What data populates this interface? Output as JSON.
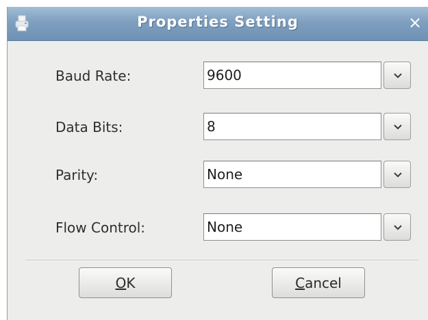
{
  "dialog": {
    "title": "Properties Setting",
    "close_glyph": "×",
    "app_icon": "printer-icon"
  },
  "fields": [
    {
      "label": "Baud Rate:",
      "value": "9600"
    },
    {
      "label": "Data Bits:",
      "value": "8"
    },
    {
      "label": "Parity:",
      "value": "None"
    },
    {
      "label": "Flow Control:",
      "value": "None"
    }
  ],
  "buttons": {
    "ok": {
      "mnemonic": "O",
      "rest": "K"
    },
    "cancel": {
      "mnemonic": "C",
      "rest": "ancel"
    }
  },
  "colors": {
    "titlebar": "#7f9fbf",
    "dialog_bg": "#ededeb"
  }
}
